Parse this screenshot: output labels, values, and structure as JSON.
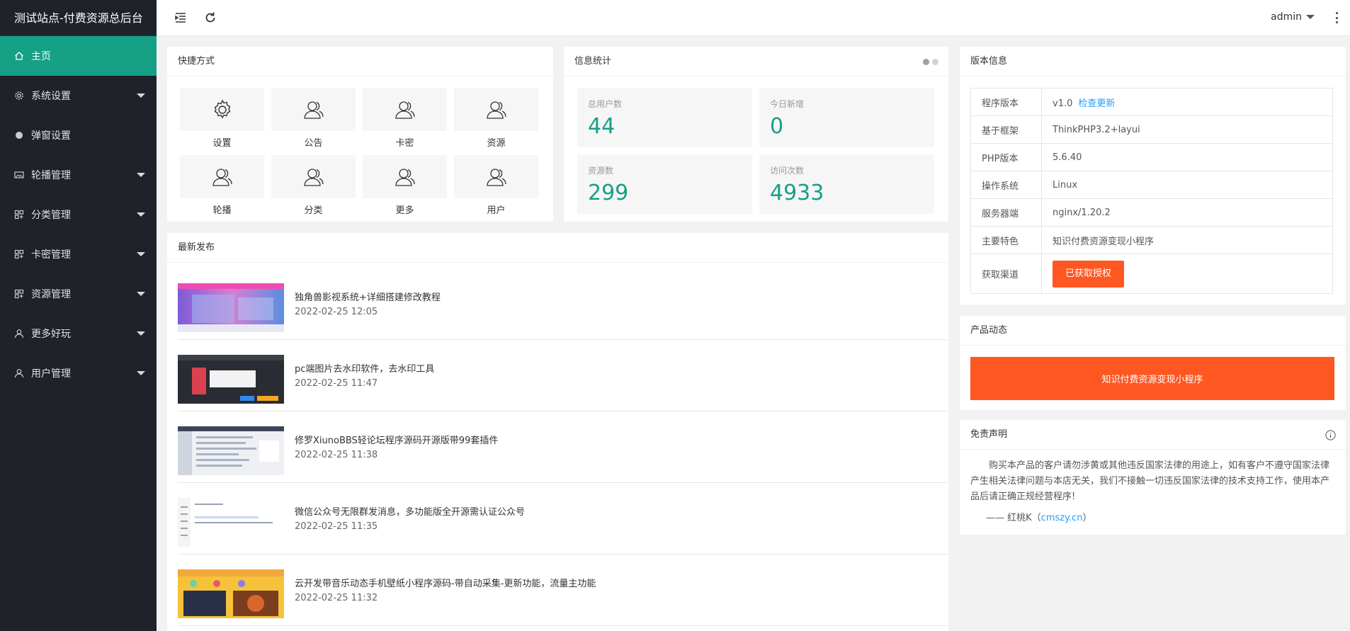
{
  "app": {
    "title": "测试站点-付费资源总后台"
  },
  "sidebar": {
    "items": [
      {
        "label": "主页",
        "icon": "home-icon",
        "active": true,
        "has_caret": false
      },
      {
        "label": "系统设置",
        "icon": "gear-icon",
        "active": false,
        "has_caret": true
      },
      {
        "label": "弹窗设置",
        "icon": "circle-icon",
        "active": false,
        "has_caret": false
      },
      {
        "label": "轮播管理",
        "icon": "image-icon",
        "active": false,
        "has_caret": true
      },
      {
        "label": "分类管理",
        "icon": "grid-icon",
        "active": false,
        "has_caret": true
      },
      {
        "label": "卡密管理",
        "icon": "grid-icon",
        "active": false,
        "has_caret": true
      },
      {
        "label": "资源管理",
        "icon": "grid-icon",
        "active": false,
        "has_caret": true
      },
      {
        "label": "更多好玩",
        "icon": "user-icon",
        "active": false,
        "has_caret": true
      },
      {
        "label": "用户管理",
        "icon": "user-icon",
        "active": false,
        "has_caret": true
      }
    ]
  },
  "header": {
    "user": "admin"
  },
  "shortcuts": {
    "title": "快捷方式",
    "items": [
      {
        "label": "设置",
        "icon": "gear-icon"
      },
      {
        "label": "公告",
        "icon": "users-icon"
      },
      {
        "label": "卡密",
        "icon": "users-icon"
      },
      {
        "label": "资源",
        "icon": "users-icon"
      },
      {
        "label": "轮播",
        "icon": "users-icon"
      },
      {
        "label": "分类",
        "icon": "users-icon"
      },
      {
        "label": "更多",
        "icon": "users-icon"
      },
      {
        "label": "用户",
        "icon": "users-icon"
      }
    ]
  },
  "stats": {
    "title": "信息统计",
    "items": [
      {
        "label": "总用户数",
        "value": "44"
      },
      {
        "label": "今日新增",
        "value": "0"
      },
      {
        "label": "资源数",
        "value": "299"
      },
      {
        "label": "访问次数",
        "value": "4933"
      }
    ]
  },
  "version": {
    "title": "版本信息",
    "rows": [
      {
        "key": "程序版本",
        "value": "v1.0",
        "link": "检查更新"
      },
      {
        "key": "基于框架",
        "value": "ThinkPHP3.2+layui"
      },
      {
        "key": "PHP版本",
        "value": "5.6.40"
      },
      {
        "key": "操作系统",
        "value": "Linux"
      },
      {
        "key": "服务器端",
        "value": "nginx/1.20.2"
      },
      {
        "key": "主要特色",
        "value": "知识付费资源变现小程序"
      },
      {
        "key": "获取渠道",
        "button": "已获取授权"
      }
    ]
  },
  "product": {
    "title": "产品动态",
    "banner": "知识付费资源变现小程序"
  },
  "disclaimer": {
    "title": "免责声明",
    "text": "购买本产品的客户请勿涉黄或其他违反国家法律的用途上，如有客户不遵守国家法律 产生相关法律问题与本店无关，我们不接触一切违反国家法律的技术支持工作，使用本产品后请正确正规经营程序!",
    "sign_prefix": "—— 红桃K（",
    "sign_link": "cmszy.cn",
    "sign_suffix": "）"
  },
  "latest": {
    "title": "最新发布",
    "items": [
      {
        "title": "独角兽影视系统+详细搭建修改教程",
        "date": "2022-02-25 12:05"
      },
      {
        "title": "pc端图片去水印软件，去水印工具",
        "date": "2022-02-25 11:47"
      },
      {
        "title": "修罗XiunoBBS轻论坛程序源码开源版带99套插件",
        "date": "2022-02-25 11:38"
      },
      {
        "title": "微信公众号无限群发消息，多功能版全开源需认证公众号",
        "date": "2022-02-25 11:35"
      },
      {
        "title": "云开发带音乐动态手机壁纸小程序源码-带自动采集-更新功能，流量主功能",
        "date": "2022-02-25 11:32"
      }
    ]
  },
  "colors": {
    "accent": "#16a086",
    "sidebar": "#20222a",
    "warn": "#ff5722",
    "link": "#1e9fff"
  }
}
